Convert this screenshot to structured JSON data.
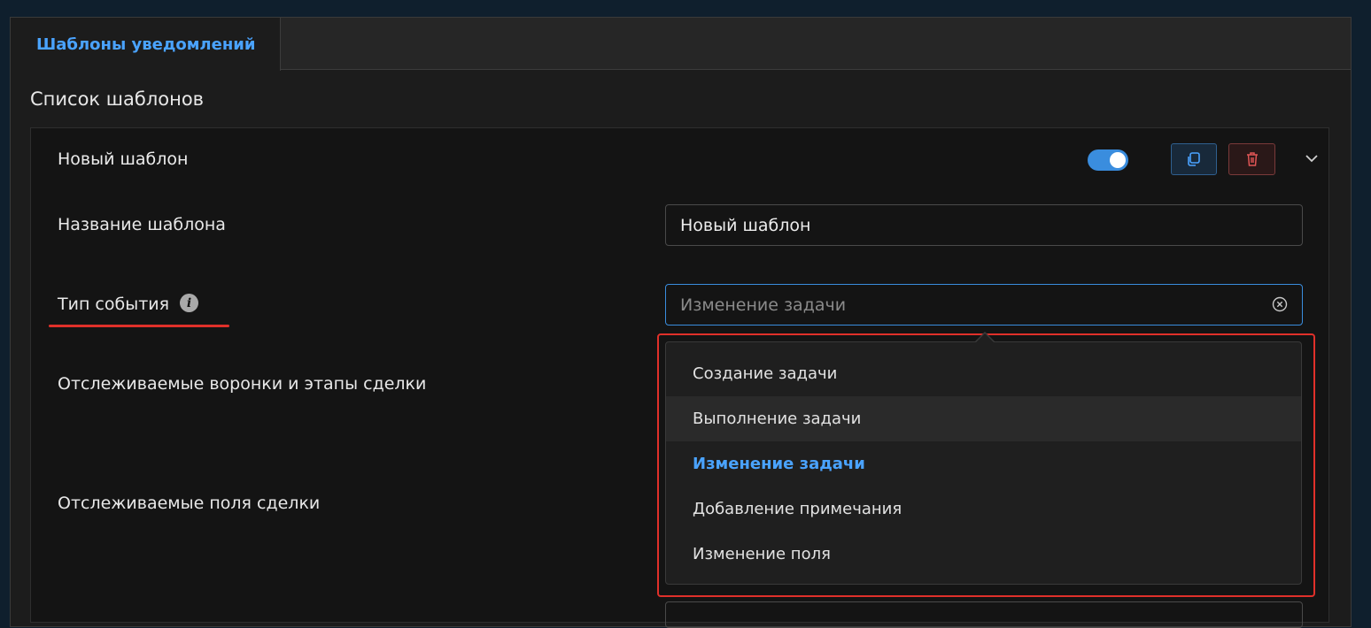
{
  "tabs": [
    {
      "label": "Шаблоны уведомлений",
      "active": true
    }
  ],
  "section_title": "Список шаблонов",
  "template_card": {
    "title": "Новый шаблон",
    "enabled": true,
    "toggle_color": "#3a8dde",
    "actions": {
      "copy_icon": "copy-icon",
      "delete_icon": "trash-icon",
      "expand_icon": "chevron-down-icon"
    }
  },
  "fields": {
    "template_name": {
      "label": "Название шаблона",
      "value": "Новый шаблон"
    },
    "event_type": {
      "label": "Тип события",
      "info_icon": "info-icon",
      "selected_value": "Изменение задачи"
    },
    "tracked_funnels": {
      "label": "Отслеживаемые воронки и этапы сделки"
    },
    "tracked_fields": {
      "label": "Отслеживаемые поля сделки"
    }
  },
  "event_type_options": [
    {
      "label": "Создание задачи",
      "state": "normal"
    },
    {
      "label": "Выполнение задачи",
      "state": "hover"
    },
    {
      "label": "Изменение задачи",
      "state": "selected"
    },
    {
      "label": "Добавление примечания",
      "state": "normal"
    },
    {
      "label": "Изменение поля",
      "state": "normal"
    }
  ],
  "colors": {
    "accent": "#4aa3ff",
    "annotation_red": "#e0302a"
  }
}
